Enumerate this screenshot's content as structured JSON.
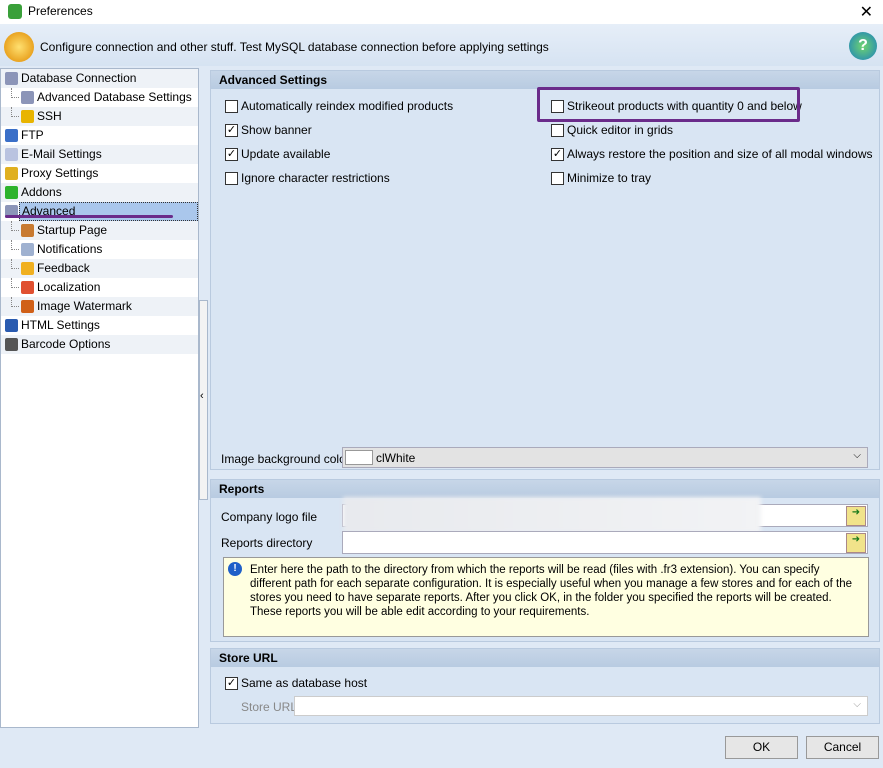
{
  "window": {
    "title": "Preferences",
    "header": "Configure connection and other stuff. Test MySQL database connection before applying settings"
  },
  "tree": [
    {
      "label": "Database Connection",
      "level": 0,
      "color": "#8c95b8"
    },
    {
      "label": "Advanced Database Settings",
      "level": 1,
      "color": "#8c95b8"
    },
    {
      "label": "SSH",
      "level": 1,
      "color": "#e8b400"
    },
    {
      "label": "FTP",
      "level": 0,
      "color": "#3a6fc8"
    },
    {
      "label": "E-Mail Settings",
      "level": 0,
      "color": "#b9c3e0"
    },
    {
      "label": "Proxy Settings",
      "level": 0,
      "color": "#e0b020"
    },
    {
      "label": "Addons",
      "level": 0,
      "color": "#2db32d"
    },
    {
      "label": "Advanced",
      "level": 0,
      "color": "#8c95b8",
      "selected": true
    },
    {
      "label": "Startup Page",
      "level": 1,
      "color": "#c87a30"
    },
    {
      "label": "Notifications",
      "level": 1,
      "color": "#9fb1d0"
    },
    {
      "label": "Feedback",
      "level": 1,
      "color": "#f0b020"
    },
    {
      "label": "Localization",
      "level": 1,
      "color": "#e05030"
    },
    {
      "label": "Image Watermark",
      "level": 1,
      "color": "#d06018"
    },
    {
      "label": "HTML Settings",
      "level": 0,
      "color": "#2a5bb0"
    },
    {
      "label": "Barcode Options",
      "level": 0,
      "color": "#555555"
    }
  ],
  "advanced": {
    "title": "Advanced Settings",
    "options_left": [
      {
        "label": "Automatically reindex modified products",
        "checked": false
      },
      {
        "label": "Show banner",
        "checked": true
      },
      {
        "label": "Update available",
        "checked": true
      },
      {
        "label": "Ignore character restrictions",
        "checked": false
      }
    ],
    "options_right": [
      {
        "label": "Strikeout products with quantity 0 and below",
        "checked": false
      },
      {
        "label": "Quick editor in grids",
        "checked": false
      },
      {
        "label": "Always restore the position and size of all modal windows",
        "checked": true
      },
      {
        "label": "Minimize to tray",
        "checked": false
      }
    ],
    "bg_color_label": "Image background color",
    "bg_color_value": "clWhite"
  },
  "reports": {
    "title": "Reports",
    "logo_label": "Company logo file",
    "dir_label": "Reports directory",
    "dir_value": "",
    "info": "Enter here the path to the directory from which the reports will be read (files with .fr3 extension). You can specify different path for each separate configuration. It is especially useful when you manage a few stores and for each of the stores you need to have separate reports. After you click OK, in the folder you specified the reports will be created. These reports you will be able edit according to your requirements."
  },
  "store": {
    "title": "Store URL",
    "same_label": "Same as database host",
    "same_checked": true,
    "url_label": "Store URL",
    "url_value": ""
  },
  "buttons": {
    "ok": "OK",
    "cancel": "Cancel"
  },
  "colors": {
    "highlight": "#6a2b8a",
    "selection": "#aac7ec"
  }
}
